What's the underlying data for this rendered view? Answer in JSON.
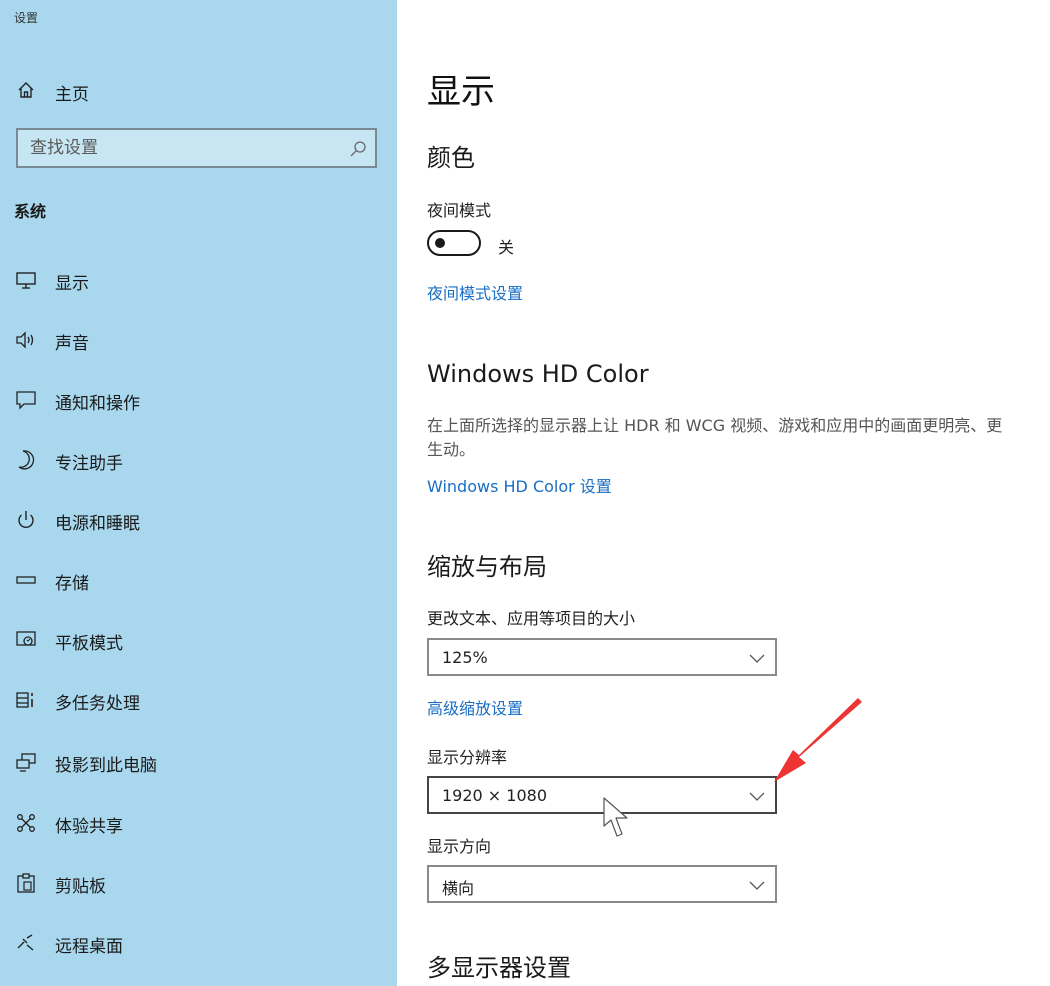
{
  "window": {
    "title": "设置"
  },
  "sidebar": {
    "home_label": "主页",
    "search_placeholder": "查找设置",
    "section_title": "系统",
    "items": [
      {
        "label": "显示",
        "icon": "monitor-icon"
      },
      {
        "label": "声音",
        "icon": "speaker-icon"
      },
      {
        "label": "通知和操作",
        "icon": "notification-icon"
      },
      {
        "label": "专注助手",
        "icon": "moon-icon"
      },
      {
        "label": "电源和睡眠",
        "icon": "power-icon"
      },
      {
        "label": "存储",
        "icon": "storage-icon"
      },
      {
        "label": "平板模式",
        "icon": "tablet-icon"
      },
      {
        "label": "多任务处理",
        "icon": "multitask-icon"
      },
      {
        "label": "投影到此电脑",
        "icon": "project-icon"
      },
      {
        "label": "体验共享",
        "icon": "share-icon"
      },
      {
        "label": "剪贴板",
        "icon": "clipboard-icon"
      },
      {
        "label": "远程桌面",
        "icon": "remote-desktop-icon"
      }
    ]
  },
  "main": {
    "title": "显示",
    "color": {
      "heading": "颜色",
      "night_mode_label": "夜间模式",
      "night_mode_state": "关",
      "night_mode_settings_link": "夜间模式设置"
    },
    "hdr": {
      "heading": "Windows HD Color",
      "description": "在上面所选择的显示器上让 HDR 和 WCG 视频、游戏和应用中的画面更明亮、更生动。",
      "link": "Windows HD Color 设置"
    },
    "scale_layout": {
      "heading": "缩放与布局",
      "scale_label": "更改文本、应用等项目的大小",
      "scale_value": "125%",
      "advanced_link": "高级缩放设置",
      "resolution_label": "显示分辨率",
      "resolution_value": "1920 × 1080",
      "orientation_label": "显示方向",
      "orientation_value": "横向"
    },
    "multi_display": {
      "heading": "多显示器设置"
    }
  },
  "colors": {
    "sidebar_bg": "#a9d8ee",
    "link": "#1a6fc4",
    "arrow": "#ee3333"
  }
}
